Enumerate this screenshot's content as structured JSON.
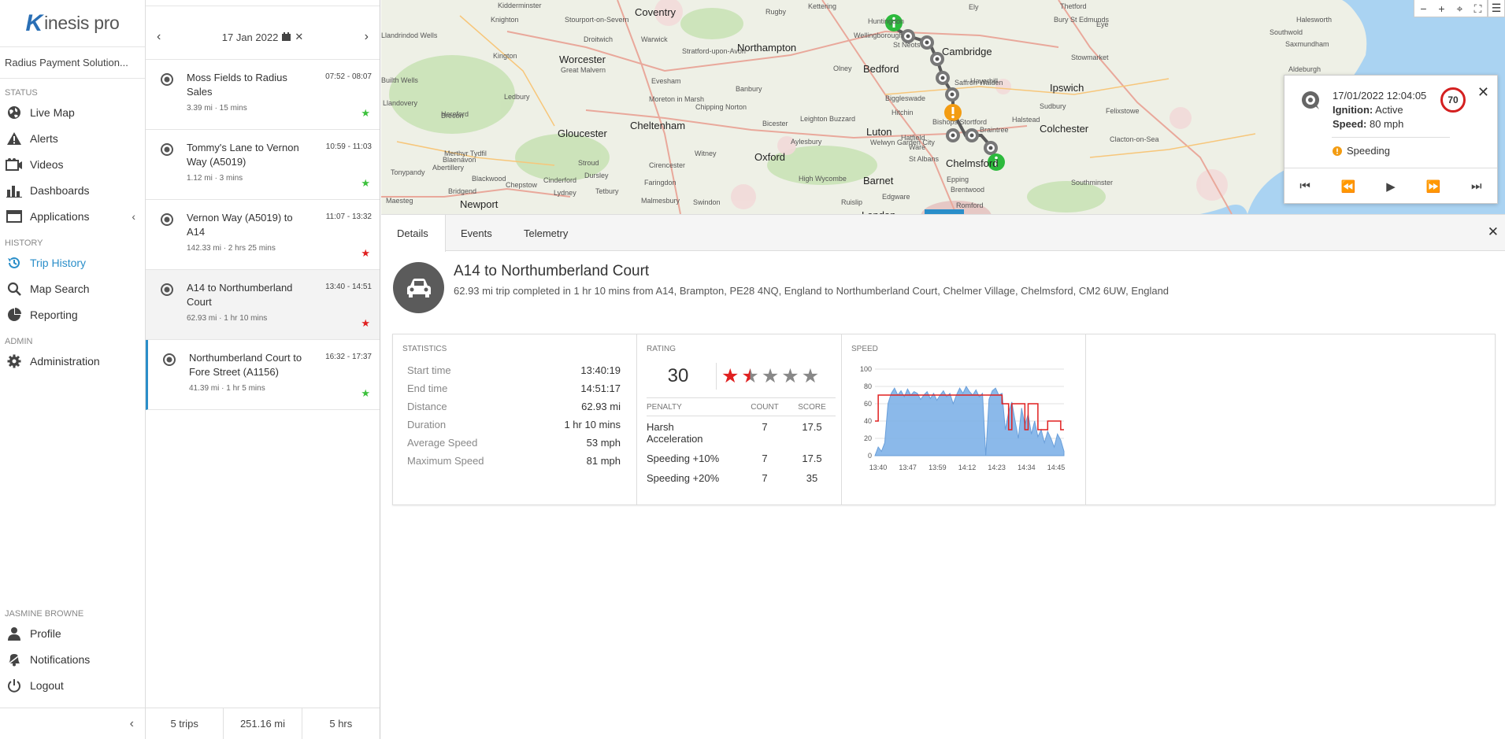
{
  "app": {
    "brand_k": "K",
    "brand_rest": "inesis pro",
    "org": "Radius Payment Solution..."
  },
  "nav": {
    "status_label": "STATUS",
    "status_items": [
      {
        "label": "Live Map",
        "icon": "globe-icon"
      },
      {
        "label": "Alerts",
        "icon": "warning-icon"
      },
      {
        "label": "Videos",
        "icon": "video-icon"
      },
      {
        "label": "Dashboards",
        "icon": "bar-chart-icon"
      },
      {
        "label": "Applications",
        "icon": "window-icon"
      }
    ],
    "history_label": "HISTORY",
    "history_items": [
      {
        "label": "Trip History",
        "icon": "history-icon"
      },
      {
        "label": "Map Search",
        "icon": "map-search-icon"
      },
      {
        "label": "Reporting",
        "icon": "pie-chart-icon"
      }
    ],
    "admin_label": "ADMIN",
    "admin_items": [
      {
        "label": "Administration",
        "icon": "gear-icon"
      }
    ],
    "user_label": "JASMINE BROWNE",
    "user_items": [
      {
        "label": "Profile",
        "icon": "user-icon"
      },
      {
        "label": "Notifications",
        "icon": "bell-icon"
      },
      {
        "label": "Logout",
        "icon": "power-icon"
      }
    ],
    "collapse": "‹"
  },
  "triplist": {
    "date": "17 Jan 2022",
    "trips": [
      {
        "name": "Moss Fields to Radius Sales",
        "time": "07:52 - 08:07",
        "meta": "3.39 mi · 15 mins",
        "star_color": "#3cc13c"
      },
      {
        "name": "Tommy's Lane to Vernon Way (A5019)",
        "time": "10:59 - 11:03",
        "meta": "1.12 mi · 3 mins",
        "star_color": "#3cc13c"
      },
      {
        "name": "Vernon Way (A5019) to A14",
        "time": "11:07 - 13:32",
        "meta": "142.33 mi · 2 hrs 25 mins",
        "star_color": "#e02020"
      },
      {
        "name": "A14 to Northumberland Court",
        "time": "13:40 - 14:51",
        "meta": "62.93 mi · 1 hr 10 mins",
        "star_color": "#e02020"
      },
      {
        "name": "Northumberland Court to Fore Street (A1156)",
        "time": "16:32 - 17:37",
        "meta": "41.39 mi · 1 hr 5 mins",
        "star_color": "#3cc13c"
      }
    ],
    "footer": {
      "trips": "5 trips",
      "distance": "251.16 mi",
      "duration": "5 hrs"
    }
  },
  "map": {
    "labels": [
      {
        "t": "Kidderminster"
      },
      {
        "t": "Coventry"
      },
      {
        "t": "Rugby"
      },
      {
        "t": "Kettering"
      },
      {
        "t": "Huntingdon"
      },
      {
        "t": "Ely"
      },
      {
        "t": "Thetford"
      },
      {
        "t": "Halesworth"
      },
      {
        "t": "Bury St Edmunds"
      },
      {
        "t": "Eye"
      },
      {
        "t": "Southwold"
      },
      {
        "t": "Knighton"
      },
      {
        "t": "Stourport-on-Severn"
      },
      {
        "t": "Droitwich"
      },
      {
        "t": "Warwick"
      },
      {
        "t": "Wellingborough"
      },
      {
        "t": "St Neots"
      },
      {
        "t": "Cambridge"
      },
      {
        "t": "Llandrindod Wells"
      },
      {
        "t": "Kington"
      },
      {
        "t": "Worcester"
      },
      {
        "t": "Stratford-upon-Avon"
      },
      {
        "t": "Northampton"
      },
      {
        "t": "Bedford"
      },
      {
        "t": "Stowmarket"
      },
      {
        "t": "Saxmundham"
      },
      {
        "t": "Aldeburgh"
      },
      {
        "t": "Great Malvern"
      },
      {
        "t": "Evesham"
      },
      {
        "t": "Olney"
      },
      {
        "t": "Haverhill"
      },
      {
        "t": "Ipswich"
      },
      {
        "t": "Builth Wells"
      },
      {
        "t": "Hereford"
      },
      {
        "t": "Ledbury"
      },
      {
        "t": "Banbury"
      },
      {
        "t": "Saffron Walden"
      },
      {
        "t": "Sudbury"
      },
      {
        "t": "Llandovery"
      },
      {
        "t": "Brecon"
      },
      {
        "t": "Moreton in Marsh"
      },
      {
        "t": "Chipping Norton"
      },
      {
        "t": "Leighton Buzzard"
      },
      {
        "t": "Luton"
      },
      {
        "t": "Hitchin"
      },
      {
        "t": "Bishops Stortford"
      },
      {
        "t": "Braintree"
      },
      {
        "t": "Colchester"
      },
      {
        "t": "Felixstowe"
      },
      {
        "t": "Gloucester"
      },
      {
        "t": "Cheltenham"
      },
      {
        "t": "Bicester"
      },
      {
        "t": "Aylesbury"
      },
      {
        "t": "Welwyn Garden City"
      },
      {
        "t": "Ware"
      },
      {
        "t": "Halstead"
      },
      {
        "t": "Clacton-on-Sea"
      },
      {
        "t": "Merthyr Tydfil"
      },
      {
        "t": "Abertillery"
      },
      {
        "t": "Stroud"
      },
      {
        "t": "Cirencester"
      },
      {
        "t": "Witney"
      },
      {
        "t": "Oxford"
      },
      {
        "t": "St Albans"
      },
      {
        "t": "Chelmsford"
      },
      {
        "t": "Blackwood"
      },
      {
        "t": "Chepstow"
      },
      {
        "t": "Dursley"
      },
      {
        "t": "Faringdon"
      },
      {
        "t": "High Wycombe"
      },
      {
        "t": "Barnet"
      },
      {
        "t": "Epping"
      },
      {
        "t": "Brentwood"
      },
      {
        "t": "Southminster"
      },
      {
        "t": "Maesteg"
      },
      {
        "t": "Newport"
      },
      {
        "t": "Tetbury"
      },
      {
        "t": "Malmesbury"
      },
      {
        "t": "Swindon"
      },
      {
        "t": "Edgware"
      },
      {
        "t": "Ruislip"
      },
      {
        "t": "Romford"
      },
      {
        "t": "London"
      },
      {
        "t": "Blaenavon"
      },
      {
        "t": "Tonypandy"
      },
      {
        "t": "Bridgend"
      },
      {
        "t": "Cinderford"
      },
      {
        "t": "Lydney"
      },
      {
        "t": "Hatfield"
      },
      {
        "t": "Biggleswade"
      }
    ],
    "controls": {
      "zoom_out": "−",
      "zoom_in": "+",
      "locate": "⌖",
      "fullscreen": "⛶",
      "menu": "☰"
    }
  },
  "popup": {
    "time": "17/01/2022 12:04:05",
    "ignition_label": "Ignition:",
    "ignition_value": "Active",
    "speed_label": "Speed:",
    "speed_value": "80 mph",
    "limit": "70",
    "warning": "Speeding",
    "close": "✕"
  },
  "tabs": {
    "details": "Details",
    "events": "Events",
    "telemetry": "Telemetry",
    "close": "✕"
  },
  "trip": {
    "title": "A14 to Northumberland Court",
    "desc": "62.93 mi trip completed in 1 hr 10 mins from A14, Brampton, PE28 4NQ, England to Northumberland Court, Chelmer Village, Chelmsford, CM2 6UW, England"
  },
  "stats": {
    "heading": "STATISTICS",
    "rows": [
      {
        "label": "Start time",
        "value": "13:40:19"
      },
      {
        "label": "End time",
        "value": "14:51:17"
      },
      {
        "label": "Distance",
        "value": "62.93 mi"
      },
      {
        "label": "Duration",
        "value": "1 hr 10 mins"
      },
      {
        "label": "Average Speed",
        "value": "53 mph"
      },
      {
        "label": "Maximum Speed",
        "value": "81 mph"
      }
    ]
  },
  "rating": {
    "heading": "RATING",
    "score": "30",
    "stars": 1.5,
    "star_on": "#e02020",
    "star_off": "#888888",
    "headers": {
      "penalty": "PENALTY",
      "count": "COUNT",
      "score": "SCORE"
    },
    "rows": [
      {
        "penalty": "Harsh Acceleration",
        "count": "7",
        "score": "17.5"
      },
      {
        "penalty": "Speeding +10%",
        "count": "7",
        "score": "17.5"
      },
      {
        "penalty": "Speeding +20%",
        "count": "7",
        "score": "35"
      }
    ]
  },
  "speed": {
    "heading": "SPEED",
    "chart_data": {
      "type": "area",
      "x_ticks": [
        "13:40",
        "13:47",
        "13:59",
        "14:12",
        "14:23",
        "14:34",
        "14:45"
      ],
      "ylim": [
        0,
        100
      ],
      "y_ticks": [
        "0",
        "20",
        "40",
        "60",
        "80",
        "100"
      ],
      "grid": true,
      "speed_color": "#7fb2e8",
      "limit_color": "#e02020",
      "speed": [
        0,
        10,
        5,
        15,
        60,
        72,
        78,
        70,
        75,
        68,
        77,
        70,
        74,
        72,
        65,
        70,
        74,
        66,
        72,
        64,
        70,
        75,
        68,
        72,
        60,
        70,
        78,
        72,
        80,
        74,
        70,
        76,
        68,
        72,
        0,
        65,
        75,
        78,
        70,
        72,
        30,
        50,
        62,
        40,
        20,
        55,
        35,
        48,
        25,
        40,
        22,
        30,
        15,
        28,
        20,
        10,
        25,
        18,
        5
      ],
      "limit": [
        40,
        70,
        70,
        70,
        70,
        70,
        70,
        70,
        70,
        70,
        70,
        70,
        70,
        70,
        70,
        70,
        70,
        70,
        70,
        70,
        70,
        70,
        70,
        70,
        70,
        70,
        70,
        70,
        70,
        70,
        70,
        70,
        70,
        70,
        70,
        70,
        70,
        70,
        70,
        60,
        60,
        30,
        60,
        60,
        60,
        60,
        30,
        60,
        60,
        60,
        30,
        30,
        30,
        40,
        40,
        40,
        40,
        30,
        30
      ]
    }
  }
}
